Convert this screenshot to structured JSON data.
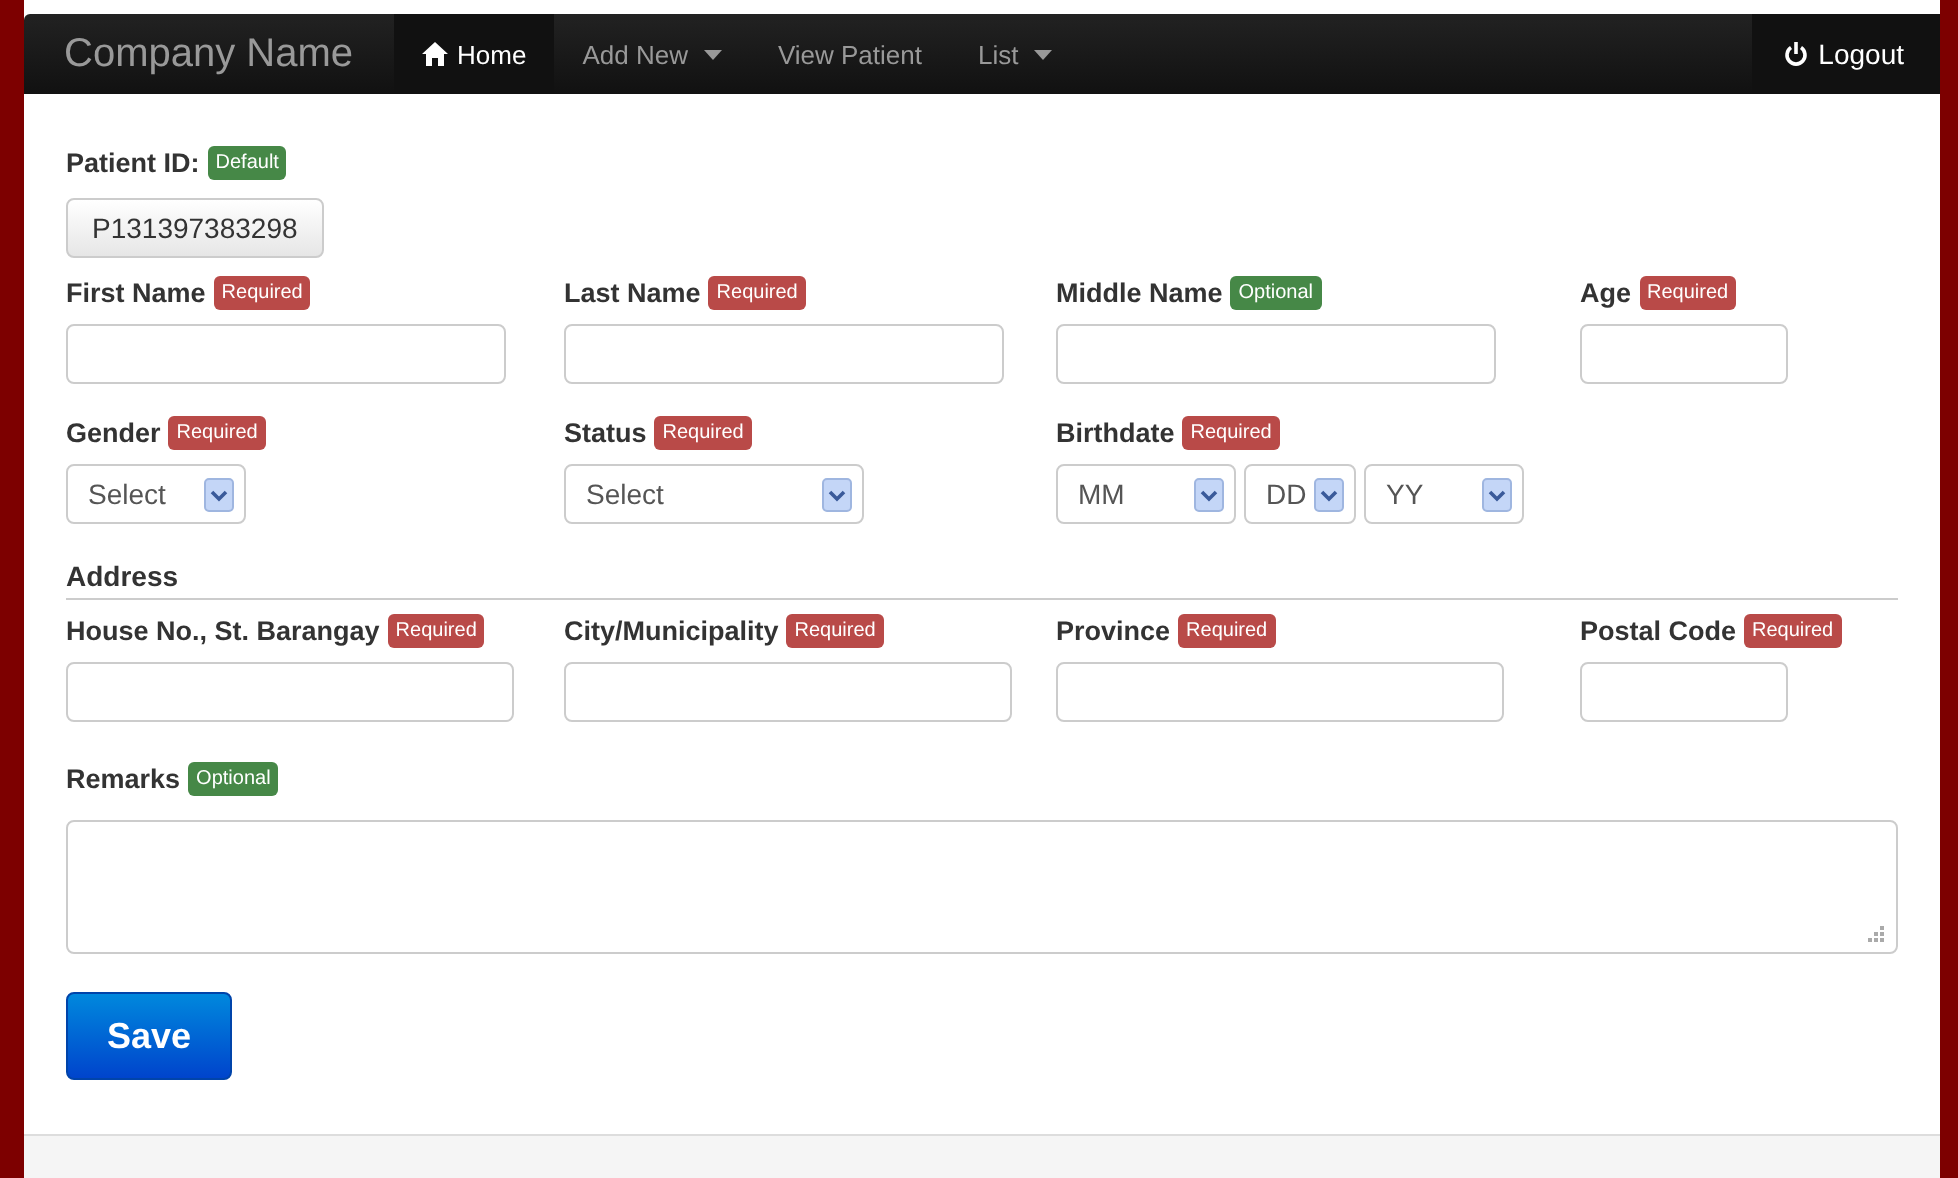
{
  "navbar": {
    "brand": "Company Name",
    "items": [
      {
        "label": "Home",
        "dropdown": false,
        "selected": true
      },
      {
        "label": "Add New",
        "dropdown": true,
        "selected": false
      },
      {
        "label": "View Patient",
        "dropdown": false,
        "selected": false
      },
      {
        "label": "List",
        "dropdown": true,
        "selected": false
      }
    ],
    "logout": "Logout"
  },
  "patient_id": {
    "label": "Patient ID:",
    "badge": {
      "text": "Default",
      "kind": "success"
    },
    "value": "P131397383298"
  },
  "row_1": [
    {
      "label": "First Name",
      "badge": {
        "text": "Required",
        "kind": "important"
      },
      "kind": "text"
    },
    {
      "label": "Last Name",
      "badge": {
        "text": "Required",
        "kind": "important"
      },
      "kind": "text"
    },
    {
      "label": "Middle Name",
      "badge": {
        "text": "Optional",
        "kind": "success"
      },
      "kind": "text"
    },
    {
      "label": "Age",
      "badge": {
        "text": "Required",
        "kind": "important"
      },
      "kind": "text"
    }
  ],
  "row_2": [
    {
      "label": "Gender",
      "badge": {
        "text": "Required",
        "kind": "important"
      },
      "selects": [
        {
          "value": "Select"
        }
      ]
    },
    {
      "label": "Status",
      "badge": {
        "text": "Required",
        "kind": "important"
      },
      "selects": [
        {
          "value": "Select"
        }
      ]
    },
    {
      "label": "Birthdate",
      "badge": {
        "text": "Required",
        "kind": "important"
      },
      "selects": [
        {
          "value": "MM"
        },
        {
          "value": "DD"
        },
        {
          "value": "YY"
        }
      ]
    }
  ],
  "address": {
    "legend": "Address",
    "fields": [
      {
        "label": "House No., St. Barangay",
        "badge": {
          "text": "Required",
          "kind": "important"
        },
        "kind": "text"
      },
      {
        "label": "City/Municipality",
        "badge": {
          "text": "Required",
          "kind": "important"
        },
        "kind": "text"
      },
      {
        "label": "Province",
        "badge": {
          "text": "Required",
          "kind": "important"
        },
        "kind": "text"
      },
      {
        "label": "Postal Code",
        "badge": {
          "text": "Required",
          "kind": "important"
        },
        "kind": "text"
      }
    ]
  },
  "remarks": {
    "label": "Remarks",
    "badge": {
      "text": "Optional",
      "kind": "success"
    }
  },
  "save_button": "Save"
}
